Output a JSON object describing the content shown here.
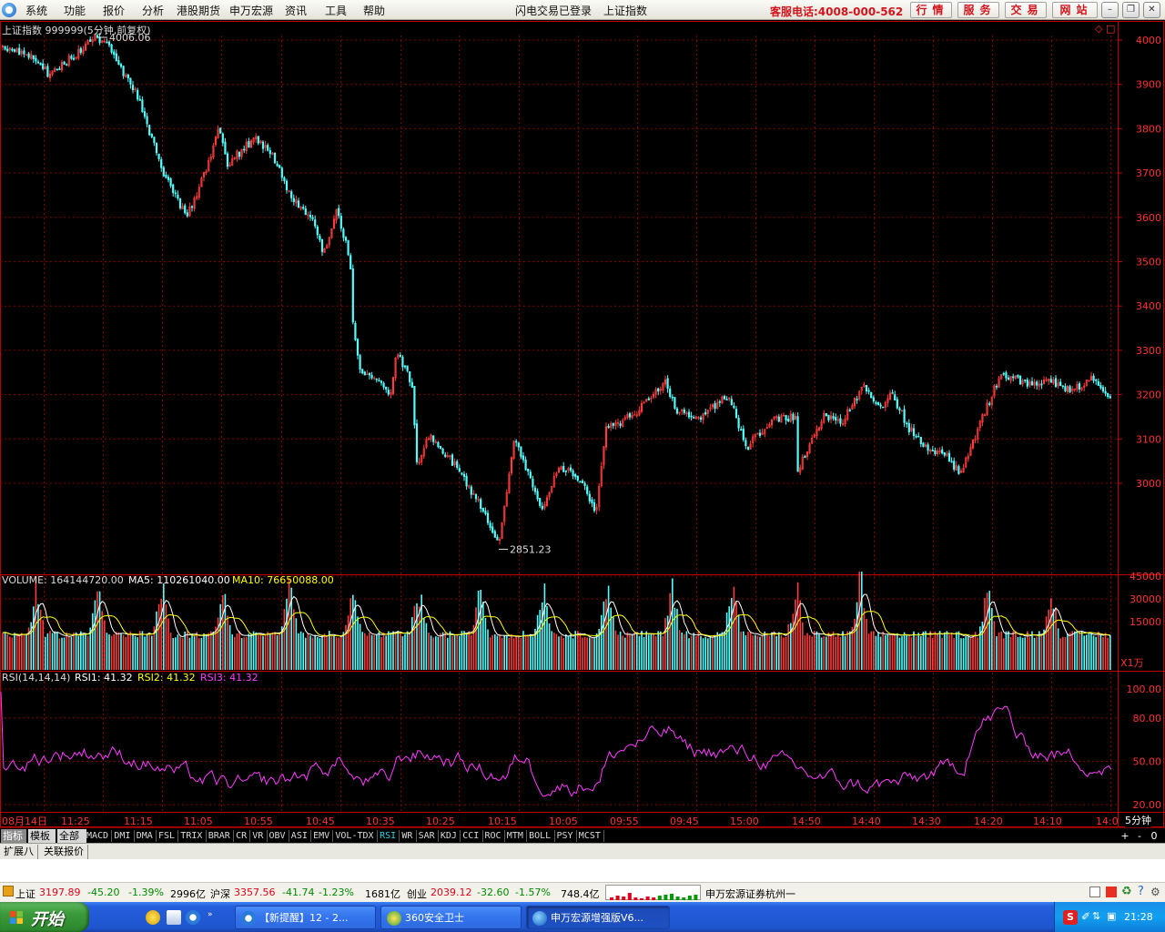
{
  "menubar": {
    "items": [
      "系统",
      "功能",
      "报价",
      "分析",
      "港股期货",
      "申万宏源",
      "资讯",
      "工具",
      "帮助"
    ],
    "login_status": "闪电交易已登录",
    "index_name": "上证指数",
    "hotline": "客服电话:4008-000-562",
    "buttons": [
      "行情",
      "服务",
      "交易",
      "网站"
    ]
  },
  "chart": {
    "header": "上证指数 999999(5分钟,前复权)",
    "high_label": "4006.06",
    "low_label": "2851.23",
    "price_ticks": [
      "4000",
      "3900",
      "3800",
      "3700",
      "3600",
      "3500",
      "3400",
      "3300",
      "3200",
      "3100",
      "3000"
    ],
    "volume_header": {
      "volume": "VOLUME: 164144720.00",
      "ma5": "MA5: 110261040.00",
      "ma10": "MA10: 76650088.00"
    },
    "volume_ticks": [
      "45000",
      "30000",
      "15000"
    ],
    "volume_unit": "X1万",
    "rsi_header": {
      "params": "RSI(14,14,14)",
      "rsi1": "RSI1: 41.32",
      "rsi2": "RSI2: 41.32",
      "rsi3": "RSI3: 41.32"
    },
    "rsi_ticks": [
      "100.00",
      "80.00",
      "50.00",
      "20.00"
    ],
    "time_axis": [
      "08月14日",
      "11:25",
      "11:15",
      "11:05",
      "10:55",
      "10:45",
      "10:35",
      "10:25",
      "10:15",
      "10:05",
      "09:55",
      "09:45",
      "15:00",
      "14:50",
      "14:40",
      "14:30",
      "14:20",
      "14:10",
      "14:0"
    ],
    "period": "5分钟",
    "colors": {
      "up": "#ff3c3c",
      "down": "#54ffff",
      "ma5": "#ffffff",
      "ma10": "#ffff00",
      "rsi": "#ff3cff",
      "grid": "#800000",
      "axis": "#c00000"
    }
  },
  "indicator_tabs": {
    "left": [
      "指标",
      "模板",
      "全部"
    ],
    "items": [
      "MACD",
      "DMI",
      "DMA",
      "FSL",
      "TRIX",
      "BRAR",
      "CR",
      "VR",
      "OBV",
      "ASI",
      "EMV",
      "VOL-TDX",
      "RSI",
      "WR",
      "SAR",
      "KDJ",
      "CCI",
      "ROC",
      "MTM",
      "BOLL",
      "PSY",
      "MCST"
    ],
    "selected": "RSI",
    "controls": [
      "+",
      "-",
      "0"
    ]
  },
  "ext_tabs": [
    "扩展八",
    "关联报价"
  ],
  "statusbar": {
    "sh": {
      "name": "上证",
      "value": "3197.89",
      "change": "-45.20",
      "pct": "-1.39%",
      "amount": "2996亿"
    },
    "hs": {
      "name": "沪深",
      "value": "3357.56",
      "change": "-41.74",
      "pct": "-1.23%",
      "amount": "1681亿"
    },
    "cy": {
      "name": "创业",
      "value": "2039.12",
      "change": "-32.60",
      "pct": "-1.57%",
      "amount": "748.4亿"
    },
    "broker": "申万宏源证券杭州一"
  },
  "taskbar": {
    "start": "开始",
    "tasks": [
      "【新提醒】12 - 2...",
      "360安全卫士",
      "申万宏源增强版V6..."
    ],
    "clock": "21:28"
  }
}
